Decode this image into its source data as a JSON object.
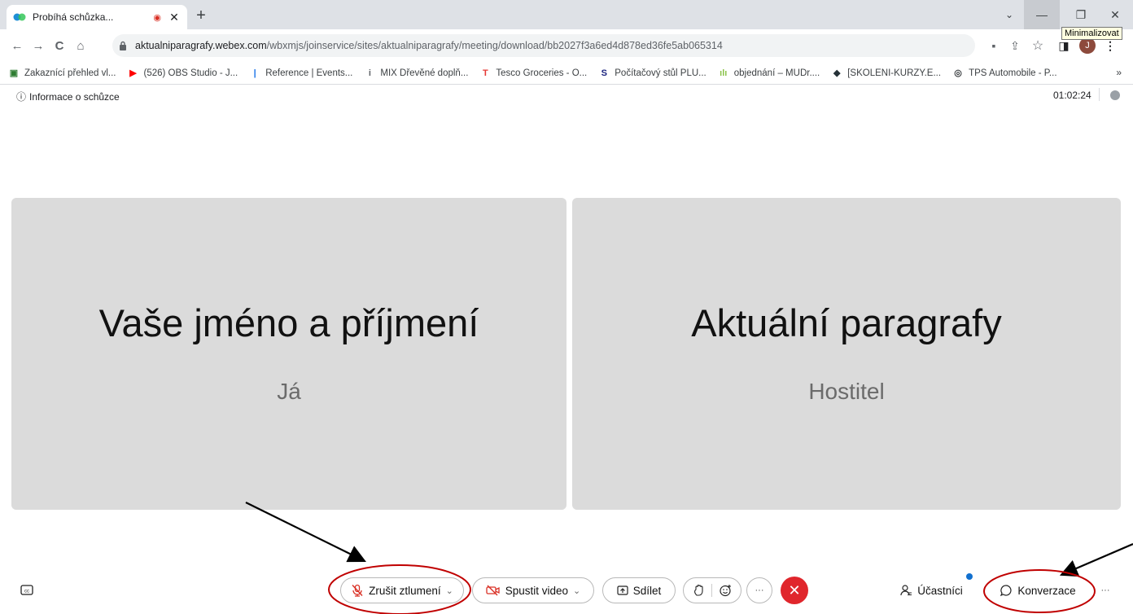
{
  "browser": {
    "tab": {
      "title": "Probíhá schůzka...",
      "recording_glyph": "◉",
      "close_glyph": "✕"
    },
    "new_tab_glyph": "+",
    "window_controls": {
      "tab_search_glyph": "⌄",
      "minimize_glyph": "—",
      "maximize_glyph": "❐",
      "close_glyph": "✕",
      "tooltip": "Minimalizovat"
    },
    "nav": {
      "back": "←",
      "forward": "→",
      "reload": "C",
      "home": "⌂"
    },
    "url_host": "aktualniparagrafy.webex.com",
    "url_path": "/wbxmjs/joinservice/sites/aktualniparagrafy/meeting/download/bb2027f3a6ed4d878ed36fe5ab065314",
    "toolbar_icons": {
      "camera": "▪",
      "share": "⇪",
      "star": "☆",
      "sidepanel": "◨",
      "menu": "⋮"
    },
    "profile_initial": "J",
    "bookmarks": [
      {
        "label": "Zakaznící přehled vl...",
        "icon": "▣",
        "color": "#2e7d32"
      },
      {
        "label": "(526) OBS Studio - J...",
        "icon": "▶",
        "color": "#ff0000"
      },
      {
        "label": "Reference | Events...",
        "icon": "|",
        "color": "#1a73e8"
      },
      {
        "label": "MIX Dřevěné doplň...",
        "icon": "i",
        "color": "#5f6368"
      },
      {
        "label": "Tesco Groceries - O...",
        "icon": "T",
        "color": "#e53935"
      },
      {
        "label": "Počítačový stůl PLU...",
        "icon": "S",
        "color": "#1a237e"
      },
      {
        "label": "objednání – MUDr....",
        "icon": "ılı",
        "color": "#8bc34a"
      },
      {
        "label": "[SKOLENI-KURZY.E...",
        "icon": "◆",
        "color": "#263238"
      },
      {
        "label": "TPS Automobile - P...",
        "icon": "◎",
        "color": "#3c4043"
      }
    ],
    "bookmarks_more": "»"
  },
  "meeting": {
    "info_label": "Informace o schůzce",
    "info_icon": "ⓘ",
    "timer": "01:02:24",
    "tiles": [
      {
        "name": "Vaše jméno a příjmení",
        "role": "Já"
      },
      {
        "name": "Aktuální paragrafy",
        "role": "Hostitel"
      }
    ],
    "controls": {
      "cc_icon": "㏄",
      "mute_label": "Zrušit ztlumení",
      "mute_icon": "🎙",
      "video_label": "Spustit video",
      "video_icon": "⧄",
      "share_label": "Sdílet",
      "share_icon": "⬆",
      "raise_hand_icon": "✋",
      "reaction_icon": "☺",
      "more_glyph": "···",
      "end_glyph": "✕",
      "participants_label": "Účastníci",
      "participants_icon": "👤",
      "chat_label": "Konverzace",
      "chat_icon": "○",
      "caret": "⌄"
    },
    "colors": {
      "end_call": "#e0262c",
      "tile_bg": "#dbdbdb",
      "notif": "#1170cf",
      "annotation": "#c00000"
    }
  }
}
